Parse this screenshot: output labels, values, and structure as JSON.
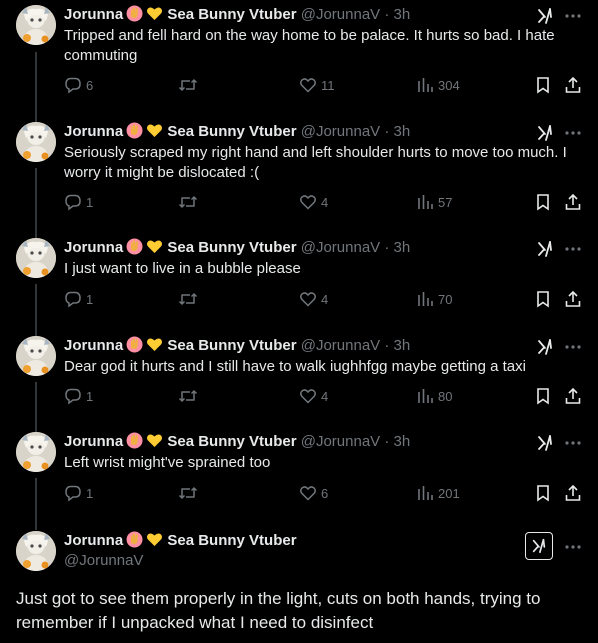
{
  "author": {
    "name": "Jorunna",
    "name_suffix": "Sea Bunny Vtuber",
    "handle": "@JorunnaV"
  },
  "separator": "·",
  "icons": {
    "name_emojis": [
      "raised-hand-emoji",
      "yellow-heart-emoji"
    ],
    "reply": "reply-icon",
    "retweet": "retweet-icon",
    "like": "like-icon",
    "views": "views-icon",
    "bookmark": "bookmark-icon",
    "share": "share-icon",
    "grok": "grok-icon",
    "more": "more-icon"
  },
  "tweets": [
    {
      "time": "3h",
      "text": "Tripped and fell hard on the way home to be palace. It hurts so bad. I hate commuting",
      "replies": "6",
      "retweets": "",
      "likes": "11",
      "views": "304"
    },
    {
      "time": "3h",
      "text": "Seriously scraped my right hand and left shoulder hurts to move too much. I worry it might be dislocated :(",
      "replies": "1",
      "retweets": "",
      "likes": "4",
      "views": "57"
    },
    {
      "time": "3h",
      "text": "I just want to live in a bubble please",
      "replies": "1",
      "retweets": "",
      "likes": "4",
      "views": "70"
    },
    {
      "time": "3h",
      "text": "Dear god it hurts and I still have to walk iughhfgg maybe getting a taxi",
      "replies": "1",
      "retweets": "",
      "likes": "4",
      "views": "80"
    },
    {
      "time": "3h",
      "text": "Left wrist might've sprained too",
      "replies": "1",
      "retweets": "",
      "likes": "6",
      "views": "201"
    }
  ],
  "main_tweet": {
    "text": "Just got to see them properly in the light, cuts on both hands, trying to remember if I unpacked what I need to disinfect"
  },
  "colors": {
    "background": "#000000",
    "text": "#e7e9ea",
    "muted": "#71767b",
    "thread_line": "#333639"
  }
}
